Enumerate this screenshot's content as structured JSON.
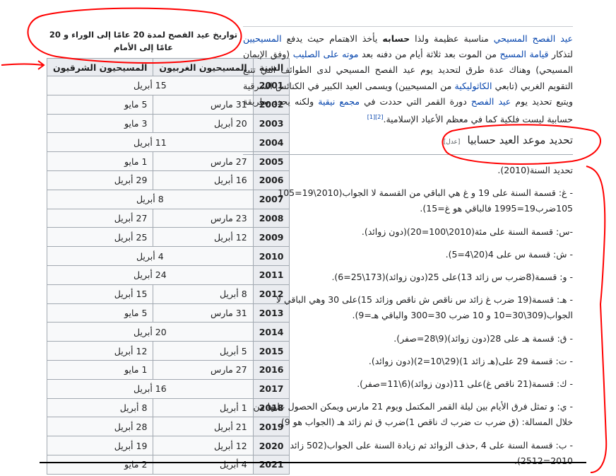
{
  "table": {
    "caption_pre": "تواريخ عيد الفصح لمدة ",
    "caption_n1": "20",
    "caption_mid": " عامًا إلى الوراء و ",
    "caption_n2": "20",
    "caption_post": " عامًا إلى الأمام",
    "headers": [
      "السنة",
      "المسيحيون الغربيون",
      "المسيحيون الشرقيون"
    ],
    "rows": [
      {
        "year": "2001",
        "same": "15 أبريل"
      },
      {
        "year": "2002",
        "west": "31 مارس",
        "east": "5 مايو"
      },
      {
        "year": "2003",
        "west": "20 أبريل",
        "east": "3 مايو"
      },
      {
        "year": "2004",
        "same": "11 أبريل"
      },
      {
        "year": "2005",
        "west": "27 مارس",
        "east": "1 مايو"
      },
      {
        "year": "2006",
        "west": "16 أبريل",
        "east": "29 أبريل"
      },
      {
        "year": "2007",
        "same": "8 أبريل"
      },
      {
        "year": "2008",
        "west": "23 مارس",
        "east": "27 أبريل"
      },
      {
        "year": "2009",
        "west": "12 أبريل",
        "east": "25 أبريل"
      },
      {
        "year": "2010",
        "same": "4 أبريل"
      },
      {
        "year": "2011",
        "same": "24 أبريل"
      },
      {
        "year": "2012",
        "west": "8 أبريل",
        "east": "15 أبريل"
      },
      {
        "year": "2013",
        "west": "31 مارس",
        "east": "5 مايو"
      },
      {
        "year": "2014",
        "same": "20 أبريل"
      },
      {
        "year": "2015",
        "west": "5 أبريل",
        "east": "12 أبريل"
      },
      {
        "year": "2016",
        "west": "27 مارس",
        "east": "1 مايو"
      },
      {
        "year": "2017",
        "same": "16 أبريل"
      },
      {
        "year": "2018",
        "west": "1 أبريل",
        "east": "8 أبريل"
      },
      {
        "year": "2019",
        "west": "21 أبريل",
        "east": "28 أبريل"
      },
      {
        "year": "2020",
        "west": "12 أبريل",
        "east": "19 أبريل"
      },
      {
        "year": "2021",
        "west": "4 أبريل",
        "east": "2 مايو"
      }
    ]
  },
  "intro": {
    "t1_link": "عيد الفصح المسيحي",
    "t2": " مناسبة عظيمة ولذا ",
    "t3_bold": "حسابه",
    "t4": " يأخذ الاهتمام حيث يدفع ",
    "t5_link": "المسيحيين",
    "t6": " لتذكار ",
    "t7_link": "قيامة المسيح",
    "t8": " من الموت بعد ثلاثة أيام من دفنه بعد ",
    "t9_link": "موته على الصليب",
    "t10": " (وفق الإيمان المسيحي) وهناك عدة طرق لتحديد يوم عيد الفصح المسيحي لدى الطوائف التي تتبع التقويم الغربي (تابعي ",
    "t11_link": "الكاثوليكية",
    "t12": " من المسيحيين) ويسمى العيد الكبير في الكنائس الشرقية ويتبع تحديد يوم ",
    "t13_link": "عيد الفصح",
    "t14": " دورة القمر التي حددت في ",
    "t15_link": "مجمع نيقية",
    "t16": " ولكنه يحدد بطريقة حسابية ليست فلكية كما في معظم الأعياد الإسلامية.",
    "ref": "[2][1]"
  },
  "section": {
    "title": "تحديد موعد العيد حسابيا",
    "edit": "[عدل]"
  },
  "steps": [
    "تحديد السنة(2010).",
    "- غ: قسمة السنة على 19 و غ هي الباقي من القسمة لا الجواب(2010\\19=105 105ضرب19=1995 فالباقي هو غ=15).",
    "-س: قسمة السنة على مئة(2010\\100=20)(دون زوائد).",
    "- ش: قسمة س على 4(20\\4=5).",
    "- و: قسمة(8ضرب س زائد 13)على 25(دون زوائد)(173\\25=6).",
    "- هـ: قسمة(19 ضرب غ زائد س ناقص ش ناقص وزائد 15)على 30 وهي الباقي لا الجواب(309\\30=10 و 10 ضرب 30=300 والباقي هـ=9).",
    "- ق: قسمة هـ على 28(دون زوائد)(9\\28=صفر).",
    "- ت: قسمة 29 على(هـ زائد 1)(29\\10=2)(دون زوائد).",
    "- ك: قسمة(21 ناقص غ)على 11(دون زوائد)(6\\11=صفر).",
    "- ي: و تمثل فرق الأيام بين ليلة القمر المكتمل ويوم 21 مارس ويمكن الحصول عليها من خلال المسالة: (ق ضرب ت ضرب ك ناقص 1)ضرب ق ثم زائد هـ (الجواب هو 9).",
    "- ب: قسمة السنة على 4 ,حذف الزوائد ثم زيادة السنة على الجواب(502 زائد 2010=2512)."
  ],
  "colors": {
    "link": "#0645ad",
    "annotation": "#ff0000",
    "header_bg": "#eaecf0",
    "border": "#a2a9b1"
  }
}
